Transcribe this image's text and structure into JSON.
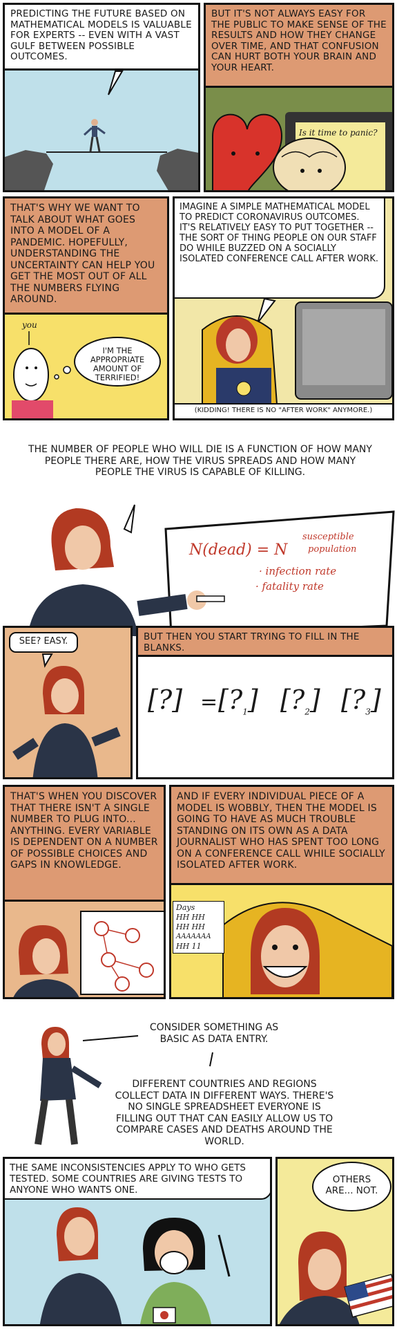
{
  "panel1": {
    "caption": "Predicting the future based on mathematical models is valuable for experts -- even with a vast gulf between possible outcomes."
  },
  "panel2": {
    "caption": "But it's not always easy for the public to make sense of the results and how they change over time, and that confusion can hurt both your brain and your heart.",
    "screen_text": "Is it time to panic?"
  },
  "panel3": {
    "caption": "That's why we want to talk about what goes into a model of a pandemic. Hopefully, understanding the uncertainty can help you get the most out of all the numbers flying around.",
    "label": "you",
    "thought": "I'm the appropriate amount of terrified!"
  },
  "panel4": {
    "speech": "Imagine a simple mathematical model to predict coronavirus outcomes. It's relatively easy to put together -- the sort of thing people on our staff do while buzzed on a socially isolated conference call after work.",
    "footnote": "(Kidding! There is no \"after work\" anymore.)"
  },
  "panel5": {
    "text": "The number of people who will die is a function of how many people there are, how the virus spreads and how many people the virus is capable of killing.",
    "formula": {
      "lhs": "N(dead) = N",
      "susceptible": "susceptible",
      "population": "population",
      "infection": "· infection rate",
      "fatality": "· fatality rate"
    }
  },
  "panel6": {
    "speech": "See? Easy."
  },
  "panel7": {
    "caption": "But then you start trying to fill in the blanks.",
    "q": "?",
    "sub1": "1",
    "sub2": "2",
    "sub3": "3",
    "eq": "="
  },
  "panel8": {
    "caption": "That's when you discover that there isn't a single number to plug into... anything. Every variable is dependent on a number of possible choices and gaps in knowledge."
  },
  "panel9": {
    "caption": "And if every individual piece of a model is wobbly, then the model is going to have as much trouble standing on its own as a data journalist who has spent too long on a conference call while socially isolated after work.",
    "days_label": "Days",
    "tally1": "HH HH",
    "tally2": "HH HH",
    "scream": "AAAAAAA",
    "tally3": "HH 11"
  },
  "panel10": {
    "text1": "Consider something as basic as data entry.",
    "text2": "Different countries and regions collect data in different ways. There's no single spreadsheet everyone is filling out that can easily allow us to compare cases and deaths around the world."
  },
  "panel11": {
    "caption": "The same inconsistencies apply to who gets tested. Some countries are giving tests to anyone who wants one."
  },
  "panel12": {
    "speech": "Others are... not."
  }
}
